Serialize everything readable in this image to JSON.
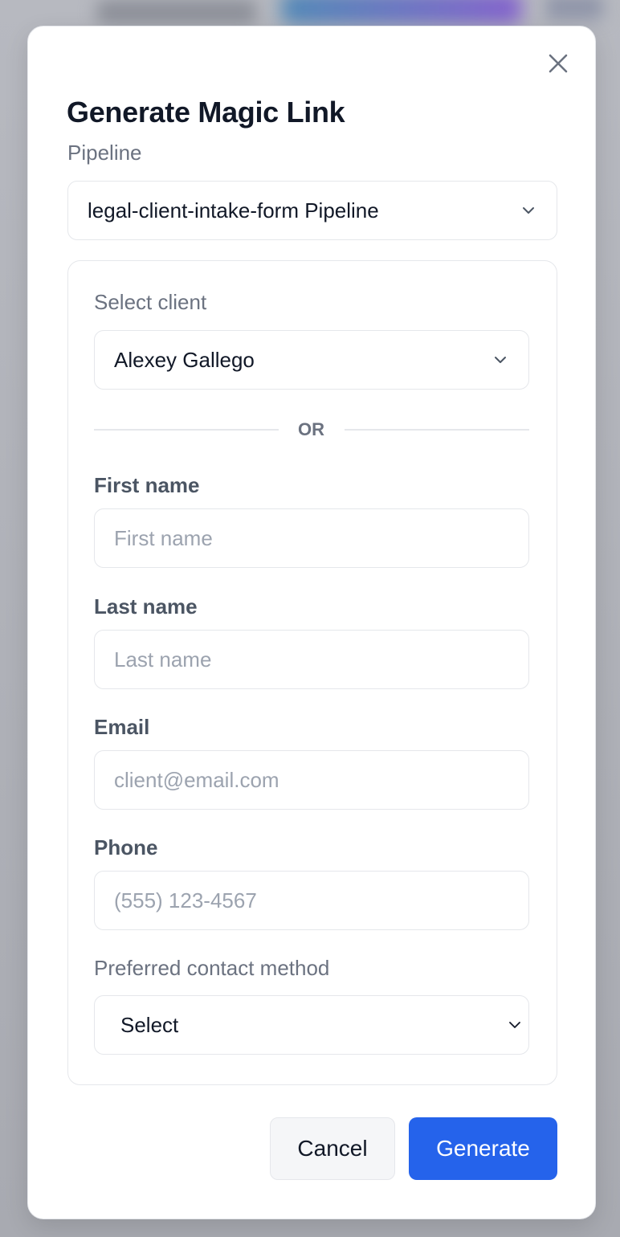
{
  "modal": {
    "title": "Generate Magic Link",
    "close_icon": "close-icon"
  },
  "pipeline": {
    "label": "Pipeline",
    "value": "legal-client-intake-form Pipeline"
  },
  "client_card": {
    "select_client_label": "Select client",
    "select_client_value": "Alexey Gallego",
    "divider_text": "OR",
    "first_name": {
      "label": "First name",
      "value": "",
      "placeholder": "First name"
    },
    "last_name": {
      "label": "Last name",
      "value": "",
      "placeholder": "Last name"
    },
    "email": {
      "label": "Email",
      "value": "",
      "placeholder": "client@email.com"
    },
    "phone": {
      "label": "Phone",
      "value": "",
      "placeholder": "(555) 123-4567"
    },
    "contact_method": {
      "label": "Preferred contact method",
      "value": "Select"
    }
  },
  "footer": {
    "cancel_label": "Cancel",
    "generate_label": "Generate"
  },
  "colors": {
    "primary": "#2563eb",
    "title": "#111827",
    "muted_label": "#6b7280",
    "border": "#e5e7eb"
  }
}
